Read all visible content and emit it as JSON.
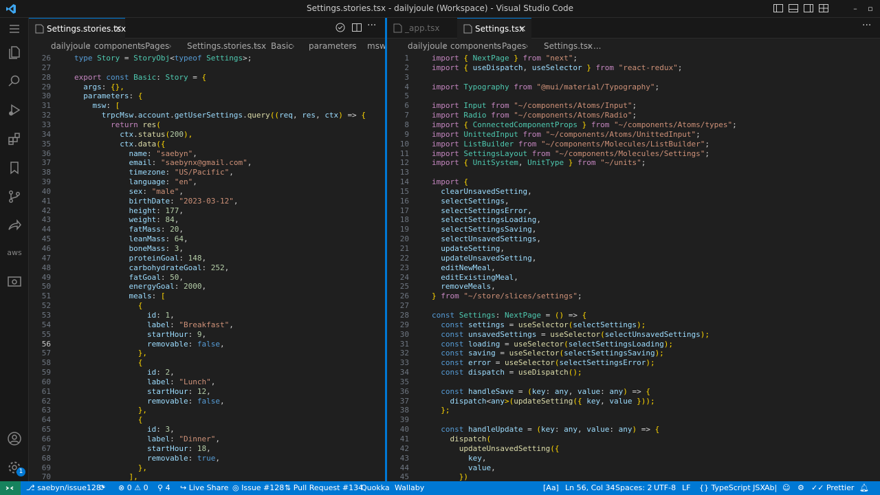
{
  "window": {
    "title": "Settings.stories.tsx - dailyjoule (Workspace) - Visual Studio Code"
  },
  "colors": {
    "accent": "#0078d4",
    "keyword": "#569cd6",
    "control": "#c586c0",
    "type": "#4ec9b0",
    "variable": "#9cdcfe",
    "string": "#ce9178",
    "number": "#b5cea8",
    "function": "#dcdcaa",
    "bracket": "#ffd700"
  },
  "left_editor": {
    "tab_label": "Settings.stories.tsx",
    "breadcrumbs": [
      "dailyjoule",
      "components",
      "Pages",
      "Settings.stories.tsx",
      "Basic",
      "parameters",
      "msw"
    ],
    "cursor_line": "56",
    "lines": [
      {
        "n": "26",
        "t": "type Story = StoryObj<typeof Settings>;"
      },
      {
        "n": "27",
        "t": ""
      },
      {
        "n": "28",
        "t": "export const Basic: Story = {"
      },
      {
        "n": "29",
        "t": "  args: {},"
      },
      {
        "n": "30",
        "t": "  parameters: {"
      },
      {
        "n": "31",
        "t": "    msw: ["
      },
      {
        "n": "32",
        "t": "      trpcMsw.account.getUserSettings.query((req, res, ctx) => {"
      },
      {
        "n": "33",
        "t": "        return res("
      },
      {
        "n": "34",
        "t": "          ctx.status(200),"
      },
      {
        "n": "35",
        "t": "          ctx.data({"
      },
      {
        "n": "36",
        "t": "            name: \"saebyn\","
      },
      {
        "n": "37",
        "t": "            email: \"saebynx@gmail.com\","
      },
      {
        "n": "38",
        "t": "            timezone: \"US/Pacific\","
      },
      {
        "n": "39",
        "t": "            language: \"en\","
      },
      {
        "n": "40",
        "t": "            sex: \"male\","
      },
      {
        "n": "41",
        "t": "            birthDate: \"2023-03-12\","
      },
      {
        "n": "42",
        "t": "            height: 177,"
      },
      {
        "n": "43",
        "t": "            weight: 84,"
      },
      {
        "n": "44",
        "t": "            fatMass: 20,"
      },
      {
        "n": "45",
        "t": "            leanMass: 64,"
      },
      {
        "n": "46",
        "t": "            boneMass: 3,"
      },
      {
        "n": "47",
        "t": "            proteinGoal: 148,"
      },
      {
        "n": "48",
        "t": "            carbohydrateGoal: 252,"
      },
      {
        "n": "49",
        "t": "            fatGoal: 50,"
      },
      {
        "n": "50",
        "t": "            energyGoal: 2000,"
      },
      {
        "n": "51",
        "t": "            meals: ["
      },
      {
        "n": "52",
        "t": "              {"
      },
      {
        "n": "53",
        "t": "                id: 1,"
      },
      {
        "n": "54",
        "t": "                label: \"Breakfast\","
      },
      {
        "n": "55",
        "t": "                startHour: 9,"
      },
      {
        "n": "56",
        "t": "                removable: false,"
      },
      {
        "n": "57",
        "t": "              },"
      },
      {
        "n": "58",
        "t": "              {"
      },
      {
        "n": "59",
        "t": "                id: 2,"
      },
      {
        "n": "60",
        "t": "                label: \"Lunch\","
      },
      {
        "n": "61",
        "t": "                startHour: 12,"
      },
      {
        "n": "62",
        "t": "                removable: false,"
      },
      {
        "n": "63",
        "t": "              },"
      },
      {
        "n": "64",
        "t": "              {"
      },
      {
        "n": "65",
        "t": "                id: 3,"
      },
      {
        "n": "66",
        "t": "                label: \"Dinner\","
      },
      {
        "n": "67",
        "t": "                startHour: 18,"
      },
      {
        "n": "68",
        "t": "                removable: true,"
      },
      {
        "n": "69",
        "t": "              },"
      },
      {
        "n": "70",
        "t": "            ],"
      }
    ]
  },
  "right_editor": {
    "tabs": [
      {
        "label": "_app.tsx",
        "active": false
      },
      {
        "label": "Settings.tsx",
        "active": true
      }
    ],
    "breadcrumbs": [
      "dailyjoule",
      "components",
      "Pages",
      "Settings.tsx",
      "..."
    ],
    "lines": [
      {
        "n": "1",
        "t": "import { NextPage } from \"next\";"
      },
      {
        "n": "2",
        "t": "import { useDispatch, useSelector } from \"react-redux\";"
      },
      {
        "n": "3",
        "t": ""
      },
      {
        "n": "4",
        "t": "import Typography from \"@mui/material/Typography\";"
      },
      {
        "n": "5",
        "t": ""
      },
      {
        "n": "6",
        "t": "import Input from \"~/components/Atoms/Input\";"
      },
      {
        "n": "7",
        "t": "import Radio from \"~/components/Atoms/Radio\";"
      },
      {
        "n": "8",
        "t": "import { ConnectedComponentProps } from \"~/components/Atoms/types\";"
      },
      {
        "n": "9",
        "t": "import UnittedInput from \"~/components/Atoms/UnittedInput\";"
      },
      {
        "n": "10",
        "t": "import ListBuilder from \"~/components/Molecules/ListBuilder\";"
      },
      {
        "n": "11",
        "t": "import SettingsLayout from \"~/components/Molecules/Settings\";"
      },
      {
        "n": "12",
        "t": "import { UnitSystem, UnitType } from \"~/units\";"
      },
      {
        "n": "13",
        "t": ""
      },
      {
        "n": "14",
        "t": "import {"
      },
      {
        "n": "15",
        "t": "  clearUnsavedSetting,"
      },
      {
        "n": "16",
        "t": "  selectSettings,"
      },
      {
        "n": "17",
        "t": "  selectSettingsError,"
      },
      {
        "n": "18",
        "t": "  selectSettingsLoading,"
      },
      {
        "n": "19",
        "t": "  selectSettingsSaving,"
      },
      {
        "n": "20",
        "t": "  selectUnsavedSettings,"
      },
      {
        "n": "21",
        "t": "  updateSetting,"
      },
      {
        "n": "22",
        "t": "  updateUnsavedSetting,"
      },
      {
        "n": "23",
        "t": "  editNewMeal,"
      },
      {
        "n": "24",
        "t": "  editExistingMeal,"
      },
      {
        "n": "25",
        "t": "  removeMeals,"
      },
      {
        "n": "26",
        "t": "} from \"~/store/slices/settings\";"
      },
      {
        "n": "27",
        "t": ""
      },
      {
        "n": "28",
        "t": "const Settings: NextPage = () => {"
      },
      {
        "n": "29",
        "t": "  const settings = useSelector(selectSettings);"
      },
      {
        "n": "30",
        "t": "  const unsavedSettings = useSelector(selectUnsavedSettings);"
      },
      {
        "n": "31",
        "t": "  const loading = useSelector(selectSettingsLoading);"
      },
      {
        "n": "32",
        "t": "  const saving = useSelector(selectSettingsSaving);"
      },
      {
        "n": "33",
        "t": "  const error = useSelector(selectSettingsError);"
      },
      {
        "n": "34",
        "t": "  const dispatch = useDispatch();"
      },
      {
        "n": "35",
        "t": ""
      },
      {
        "n": "36",
        "t": "  const handleSave = (key: any, value: any) => {"
      },
      {
        "n": "37",
        "t": "    dispatch<any>(updateSetting({ key, value }));"
      },
      {
        "n": "38",
        "t": "  };"
      },
      {
        "n": "39",
        "t": ""
      },
      {
        "n": "40",
        "t": "  const handleUpdate = (key: any, value: any) => {"
      },
      {
        "n": "41",
        "t": "    dispatch("
      },
      {
        "n": "42",
        "t": "      updateUnsavedSetting({"
      },
      {
        "n": "43",
        "t": "        key,"
      },
      {
        "n": "44",
        "t": "        value,"
      },
      {
        "n": "45",
        "t": "      })"
      }
    ]
  },
  "statusbar": {
    "branch": "saebyn/issue128*",
    "errors": "0",
    "warnings": "0",
    "ports": "4",
    "live_share": "Live Share",
    "issue": "Issue #128",
    "pull_request": "Pull Request #134",
    "quokka": "Quokka",
    "wallaby": "Wallaby",
    "match_case": "[Aa]",
    "cursor": "Ln 56, Col 34",
    "spaces": "Spaces: 2",
    "encoding": "UTF-8",
    "eol": "LF",
    "language": "TypeScript JSX",
    "ab": "Ab|",
    "prettier": "Prettier"
  },
  "activity": {
    "accounts_badge": "1",
    "aws_label": "aws"
  }
}
